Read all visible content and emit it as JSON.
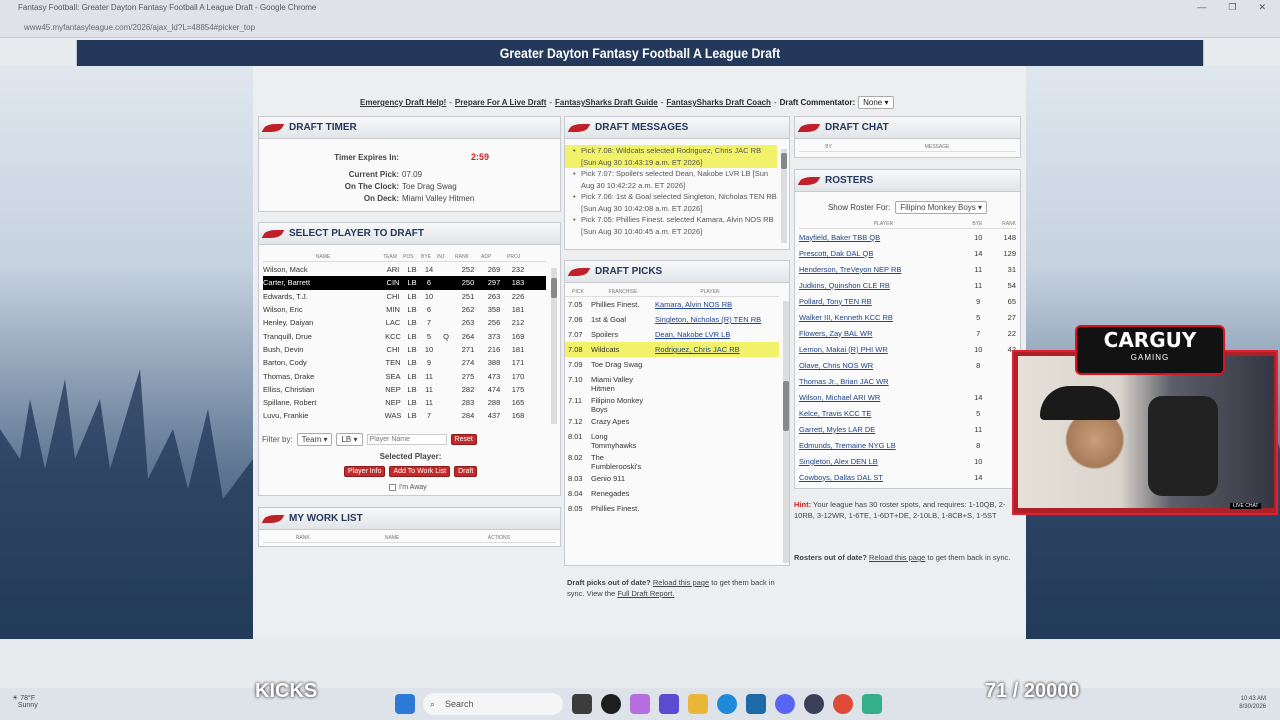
{
  "window": {
    "title": "Fantasy Football: Greater Dayton Fantasy Football A League Draft - Google Chrome",
    "url": "www45.myfantasyleague.com/2026/ajax_ld?L=48854#picker_top",
    "min": "—",
    "max": "❐",
    "close": "✕"
  },
  "banner": "Greater Dayton Fantasy Football A League Draft",
  "links": [
    "Emergency Draft Help!",
    "Prepare For A Live Draft",
    "FantasySharks Draft Guide",
    "FantasySharks Draft Coach"
  ],
  "commentator": {
    "label": "Draft Commentator:",
    "value": "None"
  },
  "timer": {
    "title": "DRAFT TIMER",
    "expires_label": "Timer Expires In:",
    "expires": "2:59",
    "current_label": "Current Pick:",
    "current": "07.09",
    "clock_label": "On The Clock:",
    "clock": "Toe Drag Swag",
    "deck_label": "On Deck:",
    "deck": "Miami Valley Hitmen"
  },
  "select": {
    "title": "SELECT PLAYER TO DRAFT",
    "headers": [
      "Name",
      "Team",
      "Pos",
      "Bye",
      "Inj",
      "Rank",
      "ADP",
      "Proj"
    ],
    "players": [
      [
        "Wilson, Mack",
        "ARI",
        "LB",
        "14",
        "",
        "252",
        "269",
        "232"
      ],
      [
        "Carter, Barrett",
        "CIN",
        "LB",
        "6",
        "",
        "250",
        "297",
        "183"
      ],
      [
        "Edwards, T.J.",
        "CHI",
        "LB",
        "10",
        "",
        "251",
        "263",
        "226"
      ],
      [
        "Wilson, Eric",
        "MIN",
        "LB",
        "6",
        "",
        "262",
        "358",
        "181"
      ],
      [
        "Henley, Daiyan",
        "LAC",
        "LB",
        "7",
        "",
        "263",
        "256",
        "212"
      ],
      [
        "Tranquill, Drue",
        "KCC",
        "LB",
        "5",
        "Q",
        "264",
        "373",
        "169"
      ],
      [
        "Bush, Devin",
        "CHI",
        "LB",
        "10",
        "",
        "271",
        "216",
        "181"
      ],
      [
        "Barton, Cody",
        "TEN",
        "LB",
        "9",
        "",
        "274",
        "388",
        "171"
      ],
      [
        "Thomas, Drake",
        "SEA",
        "LB",
        "11",
        "",
        "275",
        "473",
        "170"
      ],
      [
        "Elliss, Christian",
        "NEP",
        "LB",
        "11",
        "",
        "282",
        "474",
        "175"
      ],
      [
        "Spillane, Robert",
        "NEP",
        "LB",
        "11",
        "",
        "283",
        "288",
        "165"
      ],
      [
        "Luvu, Frankie",
        "WAS",
        "LB",
        "7",
        "",
        "284",
        "437",
        "168"
      ]
    ],
    "filter_label": "Filter by:",
    "filter_team": "Team",
    "filter_pos": "LB",
    "name_placeholder": "Player Name",
    "reset": "Reset",
    "selected_label": "Selected Player:",
    "player_info": "Player Info",
    "add_work": "Add To Work List",
    "draft": "Draft",
    "away": "I'm Away"
  },
  "worklist": {
    "title": "MY WORK LIST",
    "headers": [
      "Rank",
      "Name",
      "Actions"
    ]
  },
  "messages": {
    "title": "DRAFT MESSAGES",
    "items": [
      "Pick 7.08: Wildcats selected Rodriguez, Chris JAC RB [Sun Aug 30 10:43:19 a.m. ET 2026]",
      "Pick 7.07: Spoilers selected Dean, Nakobe LVR LB [Sun Aug 30 10:42:22 a.m. ET 2026]",
      "Pick 7.06: 1st & Goal selected Singleton, Nicholas TEN RB [Sun Aug 30 10:42:08 a.m. ET 2026]",
      "Pick 7.05: Phillies Finest. selected Kamara, Alvin NOS RB [Sun Aug 30 10:40:45 a.m. ET 2026]"
    ]
  },
  "picks": {
    "title": "DRAFT PICKS",
    "headers": [
      "Pick",
      "Franchise",
      "Player"
    ],
    "items": [
      [
        "7.05",
        "Phillies Finest.",
        "Kamara, Alvin NOS RB"
      ],
      [
        "7.06",
        "1st & Goal",
        "Singleton, Nicholas (R) TEN RB"
      ],
      [
        "7.07",
        "Spoilers",
        "Dean, Nakobe LVR LB"
      ],
      [
        "7.08",
        "Wildcats",
        "Rodriguez, Chris JAC RB"
      ],
      [
        "7.09",
        "Toe Drag Swag",
        ""
      ],
      [
        "7.10",
        "Miami Valley Hitmen",
        ""
      ],
      [
        "7.11",
        "Filipino Monkey Boys",
        ""
      ],
      [
        "7.12",
        "Crazy Apes",
        ""
      ],
      [
        "8.01",
        "Long Tommyhawks",
        ""
      ],
      [
        "8.02",
        "The Fumblerooski's",
        ""
      ],
      [
        "8.03",
        "Genio 911",
        ""
      ],
      [
        "8.04",
        "Renegades",
        ""
      ],
      [
        "8.05",
        "Phillies Finest.",
        ""
      ]
    ],
    "footer_a": "Draft picks out of date?",
    "footer_link": "Reload this page",
    "footer_b": "to get them back in sync. View the",
    "footer_link2": "Full Draft Report."
  },
  "chat": {
    "title": "DRAFT CHAT",
    "headers": [
      "By",
      "Message"
    ]
  },
  "rosters": {
    "title": "ROSTERS",
    "show_label": "Show Roster For:",
    "team": "Filipino Monkey Boys",
    "headers": [
      "Player",
      "Bye",
      "Rank"
    ],
    "items": [
      [
        "Mayfield, Baker TBB QB",
        "10",
        "148"
      ],
      [
        "Prescott, Dak DAL QB",
        "14",
        "129"
      ],
      [
        "Henderson, TreVeyon NEP RB",
        "11",
        "31"
      ],
      [
        "Judkins, Quinshon CLE RB",
        "11",
        "54"
      ],
      [
        "Pollard, Tony TEN RB",
        "9",
        "65"
      ],
      [
        "Walker III, Kenneth KCC RB",
        "5",
        "27"
      ],
      [
        "Flowers, Zay BAL WR",
        "7",
        "22"
      ],
      [
        "Lemon, Makai (R) PHI WR",
        "10",
        "42"
      ],
      [
        "Olave, Chris NOS WR",
        "8",
        ""
      ],
      [
        "Thomas Jr., Brian JAC WR",
        "",
        ""
      ],
      [
        "Wilson, Michael ARI WR",
        "14",
        ""
      ],
      [
        "Kelce, Travis KCC TE",
        "5",
        ""
      ],
      [
        "Garrett, Myles LAR DE",
        "11",
        ""
      ],
      [
        "Edmunds, Tremaine NYG LB",
        "8",
        ""
      ],
      [
        "Singleton, Alex DEN LB",
        "10",
        ""
      ],
      [
        "Cowboys, Dallas DAL ST",
        "14",
        ""
      ]
    ],
    "hint_label": "Hint:",
    "hint": "Your league has 30 roster spots, and requires: 1-10QB, 2-10RB, 3-12WR, 1-6TE, 1-6DT+DE, 2-10LB, 1-8CB+S, 1-5ST",
    "footer_a": "Rosters out of date?",
    "footer_link": "Reload this page",
    "footer_b": "to get them back in sync."
  },
  "stream": {
    "logo_a": "CARGUY",
    "logo_b": "GAMING",
    "live": "LIVE CHAT",
    "left": "KICKS",
    "right": "71 / 20000"
  },
  "taskbar": {
    "weather_temp": "78°F",
    "weather_desc": "Sunny",
    "search": "Search",
    "time": "10:43 AM",
    "date": "8/30/2026"
  }
}
